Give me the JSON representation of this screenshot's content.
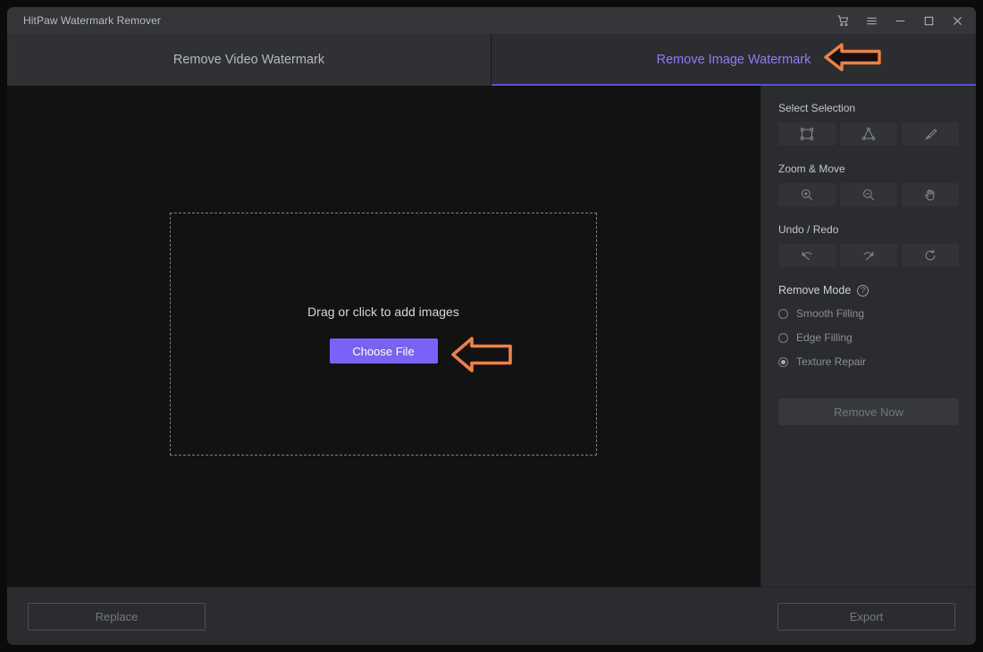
{
  "window": {
    "title": "HitPaw Watermark Remover",
    "controls": [
      {
        "name": "cart-icon",
        "label": "Cart"
      },
      {
        "name": "menu-icon",
        "label": "Menu"
      },
      {
        "name": "minimize-icon",
        "label": "Minimize"
      },
      {
        "name": "maximize-icon",
        "label": "Maximize"
      },
      {
        "name": "close-icon",
        "label": "Close"
      }
    ]
  },
  "tabs": [
    {
      "label": "Remove Video Watermark",
      "active": false
    },
    {
      "label": "Remove Image Watermark",
      "active": true
    }
  ],
  "canvas": {
    "drop_text": "Drag or click to add images",
    "choose_file_label": "Choose File"
  },
  "panel": {
    "select_selection": {
      "label": "Select Selection",
      "tools": [
        "rectangle-select-icon",
        "polygon-select-icon",
        "brush-select-icon"
      ]
    },
    "zoom_move": {
      "label": "Zoom & Move",
      "tools": [
        "zoom-in-icon",
        "zoom-out-icon",
        "hand-pan-icon"
      ]
    },
    "undo_redo": {
      "label": "Undo / Redo",
      "tools": [
        "undo-icon",
        "redo-icon",
        "reset-icon"
      ]
    },
    "remove_mode": {
      "label": "Remove Mode",
      "help_glyph": "?",
      "options": [
        {
          "label": "Smooth Filling",
          "selected": false
        },
        {
          "label": "Edge Filling",
          "selected": false
        },
        {
          "label": "Texture Repair",
          "selected": true
        }
      ]
    },
    "remove_now_label": "Remove Now"
  },
  "footer": {
    "replace_label": "Replace",
    "export_label": "Export"
  },
  "annotations": [
    {
      "name": "arrow-pointing-to-image-tab",
      "direction": "left",
      "color": "#ef8240"
    },
    {
      "name": "arrow-pointing-to-choose-file",
      "direction": "left",
      "color": "#ef8240"
    }
  ],
  "colors": {
    "accent_purple": "#7a62f6",
    "tab_active_text": "#8e7cf8",
    "annotation_orange": "#ef8240",
    "window_bg": "#2b2c2f",
    "canvas_bg": "#121213"
  }
}
